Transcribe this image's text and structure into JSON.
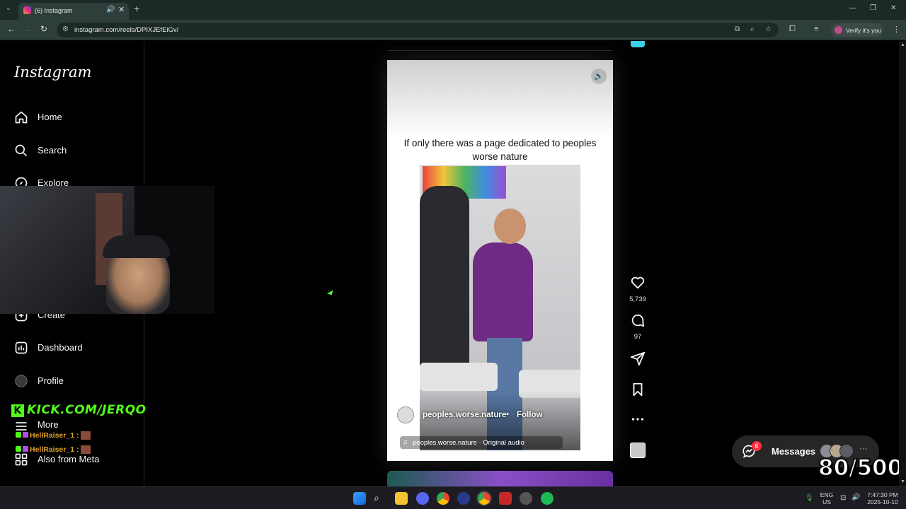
{
  "browser": {
    "tab_title": "(6) Instagram",
    "url": "instagram.com/reels/DPIXJEfEiGv/",
    "verify_label": "Verify it's you"
  },
  "sidebar": {
    "logo": "Instagram",
    "items": [
      {
        "label": "Home",
        "icon": "home-icon"
      },
      {
        "label": "Search",
        "icon": "search-icon"
      },
      {
        "label": "Explore",
        "icon": "compass-icon"
      },
      {
        "label": "Create",
        "icon": "plus-icon"
      },
      {
        "label": "Dashboard",
        "icon": "dashboard-icon"
      },
      {
        "label": "Profile",
        "icon": "avatar"
      },
      {
        "label": "More",
        "icon": "hamburger-icon"
      },
      {
        "label": "Also from Meta",
        "icon": "grid-icon"
      }
    ]
  },
  "overlay": {
    "kick_label": "KICK.COM/JERQO",
    "chat": [
      {
        "user": "HellRaiser_1",
        "sep": ":"
      },
      {
        "user": "HellRaiser_1",
        "sep": ":"
      }
    ],
    "counter": "80/500"
  },
  "reel": {
    "caption": "If only there was a page dedicated to peoples worse nature",
    "username": "peoples.worse.nature",
    "dot": "•",
    "follow_label": "Follow",
    "audio": "peoples.worse.nature · Original audio"
  },
  "actions": {
    "likes": "5,739",
    "comments": "97"
  },
  "messages": {
    "label": "Messages",
    "badge": "6"
  },
  "taskbar": {
    "lang": "ENG",
    "region": "US",
    "time": "7:47:30 PM",
    "date": "2025-10-10"
  },
  "colors": {
    "kick_green": "#53fc18",
    "chat_name": "#e0a02c",
    "notif_red": "#ff3040"
  }
}
